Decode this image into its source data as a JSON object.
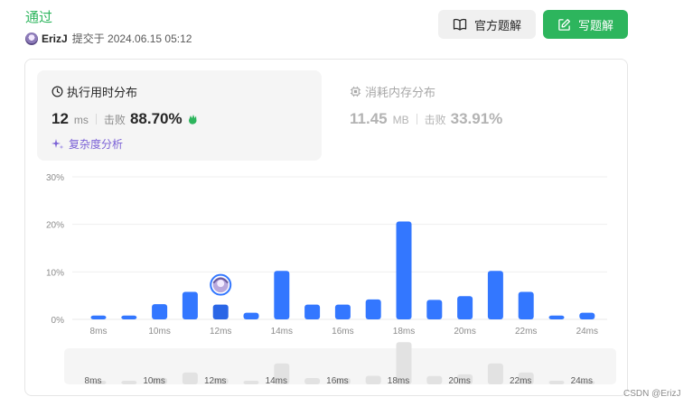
{
  "header": {
    "status": "通过",
    "username": "ErizJ",
    "submitted_text": "提交于 2024.06.15 05:12"
  },
  "buttons": {
    "solution_label": "官方题解",
    "write_label": "写题解"
  },
  "runtime": {
    "title": "执行用时分布",
    "value": "12",
    "unit": "ms",
    "beat_label": "击败",
    "beat_value": "88.70%",
    "complexity_label": "复杂度分析"
  },
  "memory": {
    "title": "消耗内存分布",
    "value": "11.45",
    "unit": "MB",
    "beat_label": "击败",
    "beat_value": "33.91%"
  },
  "colors": {
    "accent_green": "#2db55d",
    "bar_blue": "#3377ff",
    "bar_selected": "#2a66e6",
    "complexity_purple": "#7b61d6"
  },
  "chart_data": {
    "type": "bar",
    "ylim": [
      0,
      30
    ],
    "y_ticks": [
      "0%",
      "10%",
      "20%",
      "30%"
    ],
    "tick_labels": [
      "8ms",
      "10ms",
      "12ms",
      "14ms",
      "16ms",
      "18ms",
      "20ms",
      "22ms",
      "24ms"
    ],
    "categories": [
      8,
      9,
      10,
      11,
      12,
      13,
      14,
      15,
      16,
      17,
      18,
      19,
      20,
      21,
      22,
      23,
      24
    ],
    "values": [
      0.8,
      0.8,
      3.2,
      5.8,
      3.1,
      1.4,
      10.2,
      3.1,
      3.1,
      4.2,
      20.6,
      4.1,
      4.9,
      10.2,
      5.8,
      0.8,
      1.4
    ],
    "selected": 12,
    "grid": true
  },
  "overview": {
    "tick_labels": [
      "8ms",
      "10ms",
      "12ms",
      "14ms",
      "16ms",
      "18ms",
      "20ms",
      "22ms",
      "24ms"
    ]
  },
  "watermark": "CSDN @ErizJ"
}
